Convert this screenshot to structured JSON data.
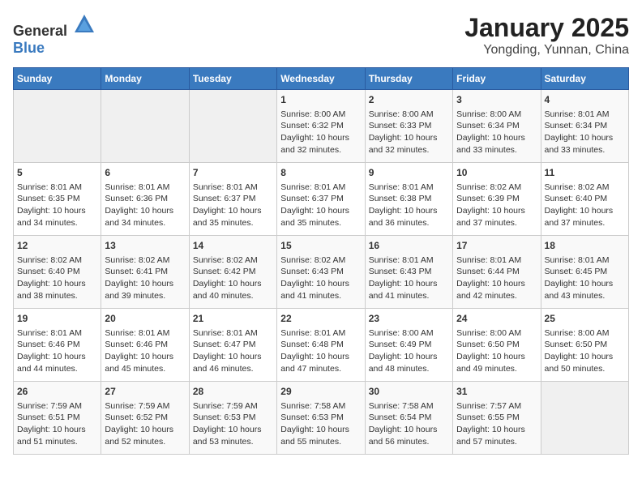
{
  "logo": {
    "general": "General",
    "blue": "Blue"
  },
  "title": "January 2025",
  "subtitle": "Yongding, Yunnan, China",
  "days_of_week": [
    "Sunday",
    "Monday",
    "Tuesday",
    "Wednesday",
    "Thursday",
    "Friday",
    "Saturday"
  ],
  "weeks": [
    [
      {
        "day": "",
        "sunrise": "",
        "sunset": "",
        "daylight": "",
        "empty": true
      },
      {
        "day": "",
        "sunrise": "",
        "sunset": "",
        "daylight": "",
        "empty": true
      },
      {
        "day": "",
        "sunrise": "",
        "sunset": "",
        "daylight": "",
        "empty": true
      },
      {
        "day": "1",
        "sunrise": "Sunrise: 8:00 AM",
        "sunset": "Sunset: 6:32 PM",
        "daylight": "Daylight: 10 hours and 32 minutes.",
        "empty": false
      },
      {
        "day": "2",
        "sunrise": "Sunrise: 8:00 AM",
        "sunset": "Sunset: 6:33 PM",
        "daylight": "Daylight: 10 hours and 32 minutes.",
        "empty": false
      },
      {
        "day": "3",
        "sunrise": "Sunrise: 8:00 AM",
        "sunset": "Sunset: 6:34 PM",
        "daylight": "Daylight: 10 hours and 33 minutes.",
        "empty": false
      },
      {
        "day": "4",
        "sunrise": "Sunrise: 8:01 AM",
        "sunset": "Sunset: 6:34 PM",
        "daylight": "Daylight: 10 hours and 33 minutes.",
        "empty": false
      }
    ],
    [
      {
        "day": "5",
        "sunrise": "Sunrise: 8:01 AM",
        "sunset": "Sunset: 6:35 PM",
        "daylight": "Daylight: 10 hours and 34 minutes.",
        "empty": false
      },
      {
        "day": "6",
        "sunrise": "Sunrise: 8:01 AM",
        "sunset": "Sunset: 6:36 PM",
        "daylight": "Daylight: 10 hours and 34 minutes.",
        "empty": false
      },
      {
        "day": "7",
        "sunrise": "Sunrise: 8:01 AM",
        "sunset": "Sunset: 6:37 PM",
        "daylight": "Daylight: 10 hours and 35 minutes.",
        "empty": false
      },
      {
        "day": "8",
        "sunrise": "Sunrise: 8:01 AM",
        "sunset": "Sunset: 6:37 PM",
        "daylight": "Daylight: 10 hours and 35 minutes.",
        "empty": false
      },
      {
        "day": "9",
        "sunrise": "Sunrise: 8:01 AM",
        "sunset": "Sunset: 6:38 PM",
        "daylight": "Daylight: 10 hours and 36 minutes.",
        "empty": false
      },
      {
        "day": "10",
        "sunrise": "Sunrise: 8:02 AM",
        "sunset": "Sunset: 6:39 PM",
        "daylight": "Daylight: 10 hours and 37 minutes.",
        "empty": false
      },
      {
        "day": "11",
        "sunrise": "Sunrise: 8:02 AM",
        "sunset": "Sunset: 6:40 PM",
        "daylight": "Daylight: 10 hours and 37 minutes.",
        "empty": false
      }
    ],
    [
      {
        "day": "12",
        "sunrise": "Sunrise: 8:02 AM",
        "sunset": "Sunset: 6:40 PM",
        "daylight": "Daylight: 10 hours and 38 minutes.",
        "empty": false
      },
      {
        "day": "13",
        "sunrise": "Sunrise: 8:02 AM",
        "sunset": "Sunset: 6:41 PM",
        "daylight": "Daylight: 10 hours and 39 minutes.",
        "empty": false
      },
      {
        "day": "14",
        "sunrise": "Sunrise: 8:02 AM",
        "sunset": "Sunset: 6:42 PM",
        "daylight": "Daylight: 10 hours and 40 minutes.",
        "empty": false
      },
      {
        "day": "15",
        "sunrise": "Sunrise: 8:02 AM",
        "sunset": "Sunset: 6:43 PM",
        "daylight": "Daylight: 10 hours and 41 minutes.",
        "empty": false
      },
      {
        "day": "16",
        "sunrise": "Sunrise: 8:01 AM",
        "sunset": "Sunset: 6:43 PM",
        "daylight": "Daylight: 10 hours and 41 minutes.",
        "empty": false
      },
      {
        "day": "17",
        "sunrise": "Sunrise: 8:01 AM",
        "sunset": "Sunset: 6:44 PM",
        "daylight": "Daylight: 10 hours and 42 minutes.",
        "empty": false
      },
      {
        "day": "18",
        "sunrise": "Sunrise: 8:01 AM",
        "sunset": "Sunset: 6:45 PM",
        "daylight": "Daylight: 10 hours and 43 minutes.",
        "empty": false
      }
    ],
    [
      {
        "day": "19",
        "sunrise": "Sunrise: 8:01 AM",
        "sunset": "Sunset: 6:46 PM",
        "daylight": "Daylight: 10 hours and 44 minutes.",
        "empty": false
      },
      {
        "day": "20",
        "sunrise": "Sunrise: 8:01 AM",
        "sunset": "Sunset: 6:46 PM",
        "daylight": "Daylight: 10 hours and 45 minutes.",
        "empty": false
      },
      {
        "day": "21",
        "sunrise": "Sunrise: 8:01 AM",
        "sunset": "Sunset: 6:47 PM",
        "daylight": "Daylight: 10 hours and 46 minutes.",
        "empty": false
      },
      {
        "day": "22",
        "sunrise": "Sunrise: 8:01 AM",
        "sunset": "Sunset: 6:48 PM",
        "daylight": "Daylight: 10 hours and 47 minutes.",
        "empty": false
      },
      {
        "day": "23",
        "sunrise": "Sunrise: 8:00 AM",
        "sunset": "Sunset: 6:49 PM",
        "daylight": "Daylight: 10 hours and 48 minutes.",
        "empty": false
      },
      {
        "day": "24",
        "sunrise": "Sunrise: 8:00 AM",
        "sunset": "Sunset: 6:50 PM",
        "daylight": "Daylight: 10 hours and 49 minutes.",
        "empty": false
      },
      {
        "day": "25",
        "sunrise": "Sunrise: 8:00 AM",
        "sunset": "Sunset: 6:50 PM",
        "daylight": "Daylight: 10 hours and 50 minutes.",
        "empty": false
      }
    ],
    [
      {
        "day": "26",
        "sunrise": "Sunrise: 7:59 AM",
        "sunset": "Sunset: 6:51 PM",
        "daylight": "Daylight: 10 hours and 51 minutes.",
        "empty": false
      },
      {
        "day": "27",
        "sunrise": "Sunrise: 7:59 AM",
        "sunset": "Sunset: 6:52 PM",
        "daylight": "Daylight: 10 hours and 52 minutes.",
        "empty": false
      },
      {
        "day": "28",
        "sunrise": "Sunrise: 7:59 AM",
        "sunset": "Sunset: 6:53 PM",
        "daylight": "Daylight: 10 hours and 53 minutes.",
        "empty": false
      },
      {
        "day": "29",
        "sunrise": "Sunrise: 7:58 AM",
        "sunset": "Sunset: 6:53 PM",
        "daylight": "Daylight: 10 hours and 55 minutes.",
        "empty": false
      },
      {
        "day": "30",
        "sunrise": "Sunrise: 7:58 AM",
        "sunset": "Sunset: 6:54 PM",
        "daylight": "Daylight: 10 hours and 56 minutes.",
        "empty": false
      },
      {
        "day": "31",
        "sunrise": "Sunrise: 7:57 AM",
        "sunset": "Sunset: 6:55 PM",
        "daylight": "Daylight: 10 hours and 57 minutes.",
        "empty": false
      },
      {
        "day": "",
        "sunrise": "",
        "sunset": "",
        "daylight": "",
        "empty": true
      }
    ]
  ]
}
